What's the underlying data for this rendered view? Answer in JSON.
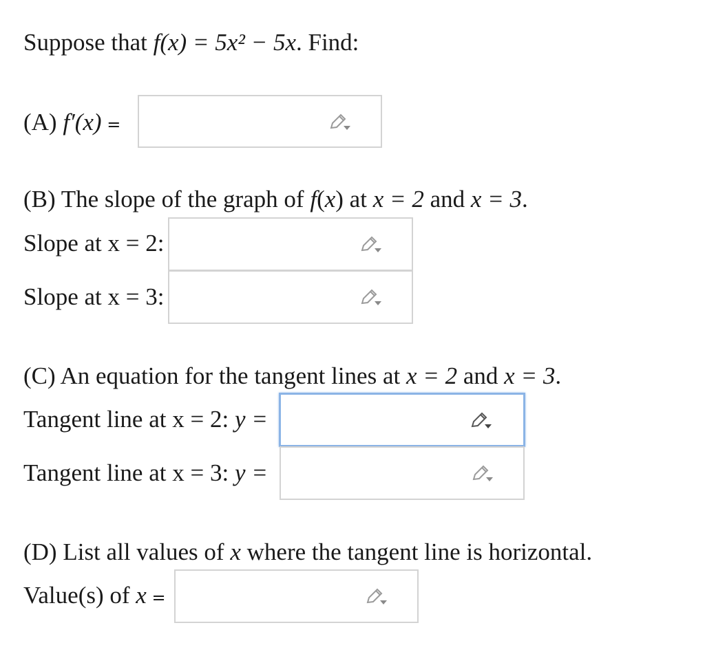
{
  "question": {
    "intro": "Suppose that ",
    "function": "f(x) = 5x² − 5x",
    "intro_end": ". Find:",
    "f": "f",
    "x": "x",
    "coef": "5",
    "exp": "2",
    "rest": " − 5",
    "eq_sign": "=",
    "lparen": "(",
    "rparen": ")"
  },
  "part_a": {
    "label": "(A) ",
    "expr": "f′(x)",
    "eq": " ="
  },
  "part_b": {
    "heading_start": "(B) The slope of the graph of ",
    "heading_mid": " at ",
    "heading_and": " and ",
    "heading_end": ".",
    "x_eq_2": "x = 2",
    "x_eq_3": "x = 3",
    "slope2_label": "Slope at x = 2:",
    "slope3_label": "Slope at x = 3:"
  },
  "part_c": {
    "heading_start": "(C) An equation for the tangent lines at ",
    "heading_and": " and ",
    "heading_end": ".",
    "x_eq_2": "x = 2",
    "x_eq_3": "x = 3",
    "tan2_label": "Tangent line at x = 2: ",
    "tan3_label": "Tangent line at x = 3: ",
    "y_eq": "y ="
  },
  "part_d": {
    "heading_start": "(D) List all values of ",
    "heading_var": "x",
    "heading_end": " where the tangent line is horizontal.",
    "values_label": "Value(s) of ",
    "values_var": "x",
    "values_eq": " ="
  },
  "icons": {
    "edit": "pencil-dropdown-icon"
  },
  "colors": {
    "active_border": "#8bb4e6",
    "box_border": "#d3d3d3"
  }
}
